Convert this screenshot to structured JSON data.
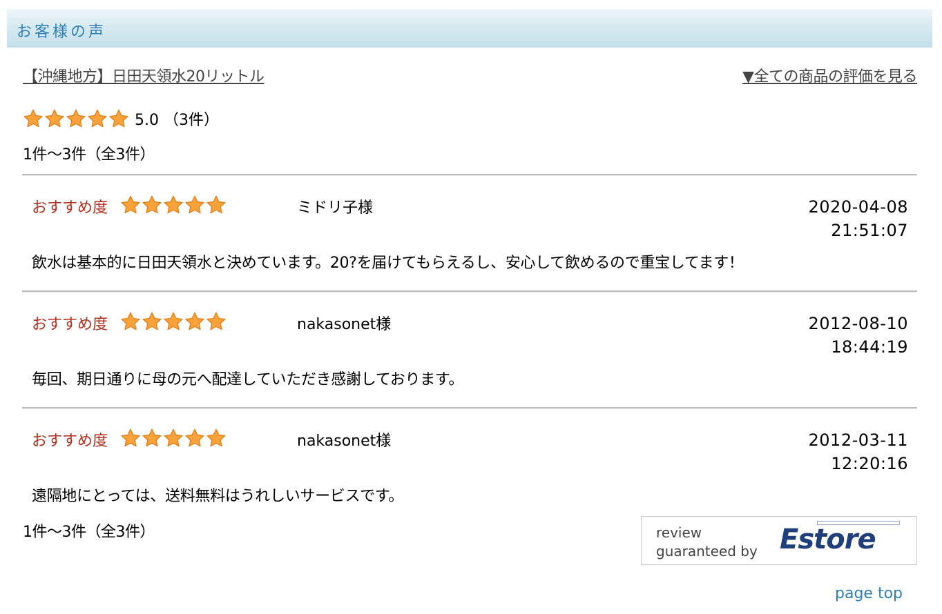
{
  "header": {
    "title": "お客様の声"
  },
  "product": {
    "link_text": "【沖縄地方】日田天領水20リットル"
  },
  "all_reviews_link": "▼全ての商品の評価を見る",
  "summary": {
    "rating": 5.0,
    "text": "5.0 （3件）",
    "star_count": 5
  },
  "range_text": "1件～3件（全3件）",
  "recommend_label": "おすすめ度",
  "reviews": [
    {
      "reviewer": "ミドリ子様",
      "date": "2020-04-08",
      "time": "21:51:07",
      "rating": 5,
      "comment": "飲水は基本的に日田天領水と決めています。20?を届けてもらえるし、安心して飲めるので重宝してます！"
    },
    {
      "reviewer": "nakasonet様",
      "date": "2012-08-10",
      "time": "18:44:19",
      "rating": 5,
      "comment": "毎回、期日通りに母の元へ配達していただき感謝しております。"
    },
    {
      "reviewer": "nakasonet様",
      "date": "2012-03-11",
      "time": "12:20:16",
      "rating": 5,
      "comment": "遠隔地にとっては、送料無料はうれしいサービスです。"
    }
  ],
  "badge": {
    "line1": "review",
    "line2": "guaranteed by",
    "logo": "Estore"
  },
  "page_top": "page top",
  "colors": {
    "header_text": "#2f7fb5",
    "recommend": "#b32d1c",
    "star": "#f7a23a"
  }
}
